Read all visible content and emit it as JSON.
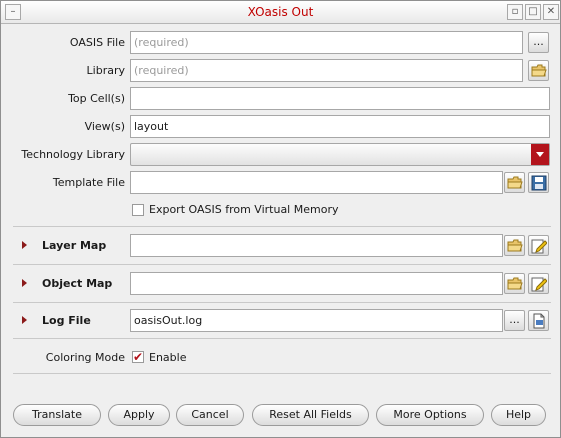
{
  "window": {
    "title": "XOasis Out",
    "system_menu": "–",
    "minimize": "▫",
    "maximize": "□",
    "close": "✕"
  },
  "form": {
    "oasis_file": {
      "label": "OASIS File",
      "placeholder": "(required)",
      "browse": "..."
    },
    "library": {
      "label": "Library",
      "placeholder": "(required)"
    },
    "top_cells": {
      "label": "Top Cell(s)",
      "value": ""
    },
    "views": {
      "label": "View(s)",
      "value": "layout"
    },
    "technology_library": {
      "label": "Technology Library",
      "value": ""
    },
    "template_file": {
      "label": "Template File",
      "value": ""
    },
    "export_virtual_memory": {
      "label": "Export OASIS from Virtual Memory",
      "checked": false
    }
  },
  "sections": {
    "layer_map": {
      "label": "Layer Map",
      "value": ""
    },
    "object_map": {
      "label": "Object Map",
      "value": ""
    },
    "log_file": {
      "label": "Log File",
      "value": "oasisOut.log",
      "browse": "..."
    }
  },
  "coloring": {
    "label": "Coloring Mode",
    "enable_label": "Enable",
    "checked": true,
    "check_glyph": "✔"
  },
  "buttons": {
    "translate": "Translate",
    "apply": "Apply",
    "cancel": "Cancel",
    "reset": "Reset All Fields",
    "more_options": "More Options",
    "help": "Help"
  },
  "colors": {
    "accent": "#b3141c",
    "title": "#c00000"
  }
}
